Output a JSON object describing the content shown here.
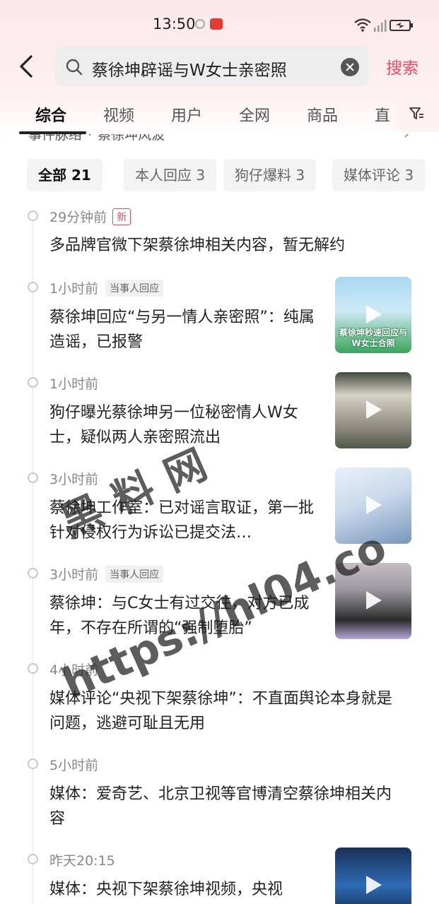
{
  "status_bar": {
    "time": "13:50",
    "icons": [
      "ring-icon",
      "app-notification-icon",
      "wifi-icon",
      "signal-icon",
      "battery-icon"
    ]
  },
  "search": {
    "query": "蔡徐坤辟谣与W女士亲密照",
    "submit_label": "搜索"
  },
  "tabs": [
    {
      "label": "综合",
      "active": true
    },
    {
      "label": "视频",
      "active": false
    },
    {
      "label": "用户",
      "active": false
    },
    {
      "label": "全网",
      "active": false
    },
    {
      "label": "商品",
      "active": false
    },
    {
      "label": "直",
      "active": false
    }
  ],
  "event": {
    "header_label": "事件脉络",
    "header_topic": "蔡徐坤风波"
  },
  "chips": [
    {
      "label": "全部 21",
      "active": true
    },
    {
      "label": "本人回应 3",
      "active": false
    },
    {
      "label": "狗仔爆料 3",
      "active": false
    },
    {
      "label": "媒体评论 3",
      "active": false
    }
  ],
  "timeline": [
    {
      "time": "29分钟前",
      "badge": "新",
      "badge_type": "new",
      "title": "多品牌官微下架蔡徐坤相关内容，暂无解约",
      "has_thumb": false
    },
    {
      "time": "1小时前",
      "badge": "当事人回应",
      "badge_type": "tag",
      "title": "蔡徐坤回应“与另一情人亲密照”：纯属造谣，已报警",
      "has_thumb": true,
      "thumb_caption": "蔡徐坤秒速回应与W女士合照",
      "thumb_colors": [
        "#9fd4f0",
        "#3aa65a"
      ]
    },
    {
      "time": "1小时前",
      "badge": "",
      "badge_type": "",
      "title": "狗仔曝光蔡徐坤另一位秘密情人W女士，疑似两人亲密照流出",
      "has_thumb": true,
      "thumb_caption": "",
      "thumb_colors": [
        "#d9d3c8",
        "#6f6a60"
      ]
    },
    {
      "time": "3小时前",
      "badge": "",
      "badge_type": "",
      "title": "蔡徐坤工作室：已对谣言取证，第一批针对侵权行为诉讼已提交法…",
      "has_thumb": true,
      "thumb_caption": "",
      "thumb_colors": [
        "#d7e6f5",
        "#7f99bd"
      ]
    },
    {
      "time": "3小时前",
      "badge": "当事人回应",
      "badge_type": "tag",
      "title": "蔡徐坤：与C女士有过交往，对方已成年，不存在所谓的“强制堕胎”",
      "has_thumb": true,
      "thumb_caption": "",
      "thumb_colors": [
        "#b9b5b8",
        "#2a2a2a"
      ]
    },
    {
      "time": "4小时前",
      "badge": "",
      "badge_type": "",
      "title": "媒体评论“央视下架蔡徐坤”：不直面舆论本身就是问题，逃避可耻且无用",
      "has_thumb": false
    },
    {
      "time": "5小时前",
      "badge": "",
      "badge_type": "",
      "title": "媒体：爱奇艺、北京卫视等官博清空蔡徐坤相关内容",
      "has_thumb": false
    },
    {
      "time": "昨天20:15",
      "badge": "",
      "badge_type": "",
      "title": "媒体：央视下架蔡徐坤视频，央视",
      "has_thumb": true,
      "thumb_caption": "",
      "thumb_colors": [
        "#2b5aa0",
        "#0e1f3d"
      ]
    }
  ],
  "watermark": {
    "text": "黑 料 网",
    "url": "https://hl04.co"
  },
  "colors": {
    "accent": "#f04b63",
    "header_bg": "#fbe7ea"
  }
}
